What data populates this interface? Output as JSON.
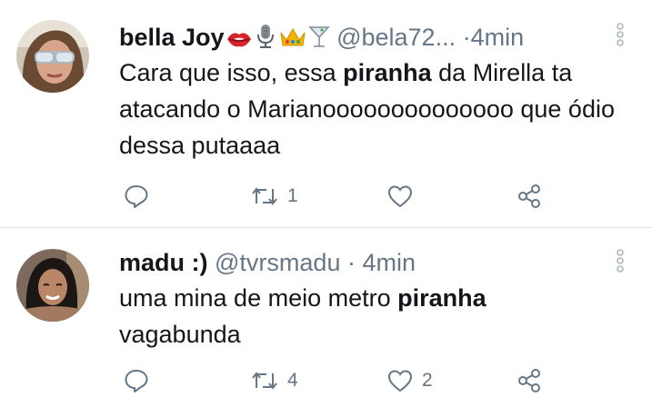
{
  "tweets": [
    {
      "display_name": "bella Joy",
      "emoji_icons": [
        "lips-icon",
        "microphone-icon",
        "crown-icon",
        "cocktail-icon"
      ],
      "handle": "@bela72...",
      "separator": "·",
      "time": "4min",
      "text_parts": {
        "p1": "Cara que isso, essa ",
        "bold": "piranha",
        "p2": " da Mirella ta atacando o Marianoooooooooooooo que ódio dessa putaaaa"
      },
      "reply_count": "",
      "retweet_count": "1",
      "like_count": ""
    },
    {
      "display_name": "madu :)",
      "handle": "@tvrsmadu",
      "separator": "·",
      "time": "4min",
      "text_parts": {
        "p1": "uma mina de meio metro ",
        "bold": "piranha",
        "p2": " vagabunda"
      },
      "reply_count": "",
      "retweet_count": "4",
      "like_count": "2"
    }
  ],
  "colors": {
    "meta_gray": "#657786",
    "text": "#14171a",
    "divider": "#d9dee2"
  }
}
